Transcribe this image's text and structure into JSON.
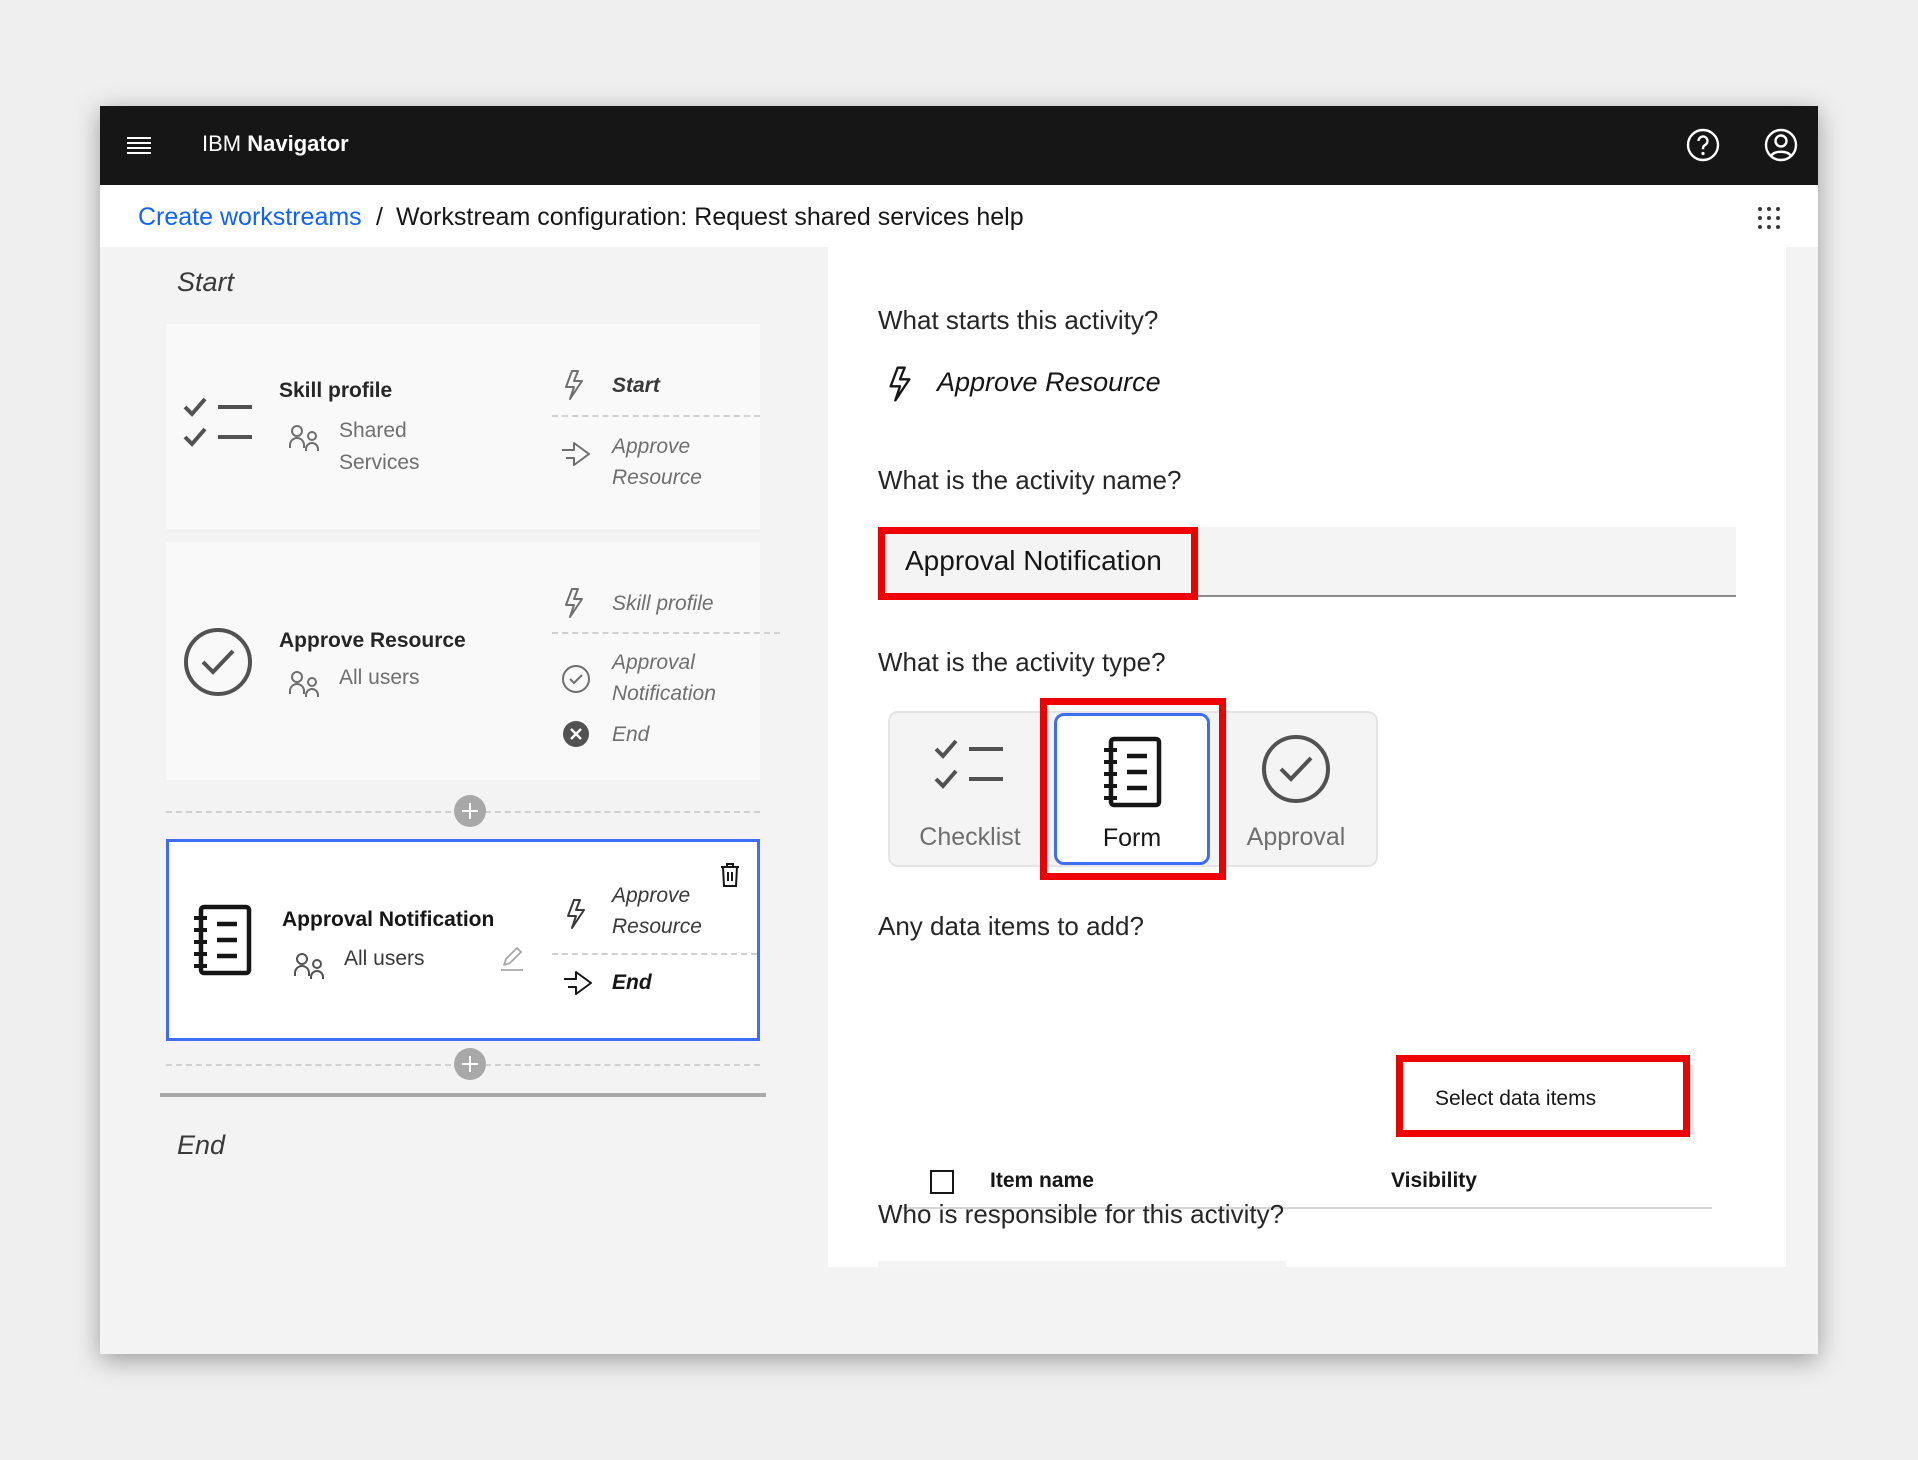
{
  "app": {
    "brand_prefix": "IBM",
    "brand_name": "Navigator"
  },
  "breadcrumb": {
    "link": "Create workstreams",
    "separator": "/",
    "current": "Workstream configuration: Request shared services help"
  },
  "flow": {
    "start_label": "Start",
    "end_label": "End",
    "cards": [
      {
        "icon": "checklist-icon",
        "title": "Skill profile",
        "user_line1": "Shared",
        "user_line2": "Services",
        "trigger_in": "Start",
        "trigger_out_line1": "Approve",
        "trigger_out_line2": "Resource"
      },
      {
        "icon": "approval-check-icon",
        "title": "Approve Resource",
        "user_line1": "All users",
        "trigger_in": "Skill profile",
        "outcome1_line1": "Approval",
        "outcome1_line2": "Notification",
        "outcome2": "End"
      },
      {
        "icon": "form-icon",
        "title": "Approval Notification",
        "user_line1": "All users",
        "trigger_in_line1": "Approve",
        "trigger_in_line2": "Resource",
        "trigger_out": "End"
      }
    ]
  },
  "panel": {
    "q_starts": "What starts this activity?",
    "start_trigger": "Approve Resource",
    "q_name": "What is the activity name?",
    "activity_name": "Approval Notification",
    "q_type": "What is the activity type?",
    "types": [
      {
        "label": "Checklist",
        "icon": "checklist-icon"
      },
      {
        "label": "Form",
        "icon": "form-icon"
      },
      {
        "label": "Approval",
        "icon": "approval-check-icon"
      }
    ],
    "selected_type": "Form",
    "q_data": "Any data items to add?",
    "select_button": "Select data items",
    "table_headers": {
      "name": "Item name",
      "visibility": "Visibility"
    },
    "q_responsible": "Who is responsible for this activity?"
  },
  "colors": {
    "topbar": "#161616",
    "link": "#0f62fe",
    "selection": "#3e6ef5",
    "highlight": "#ee0000"
  }
}
